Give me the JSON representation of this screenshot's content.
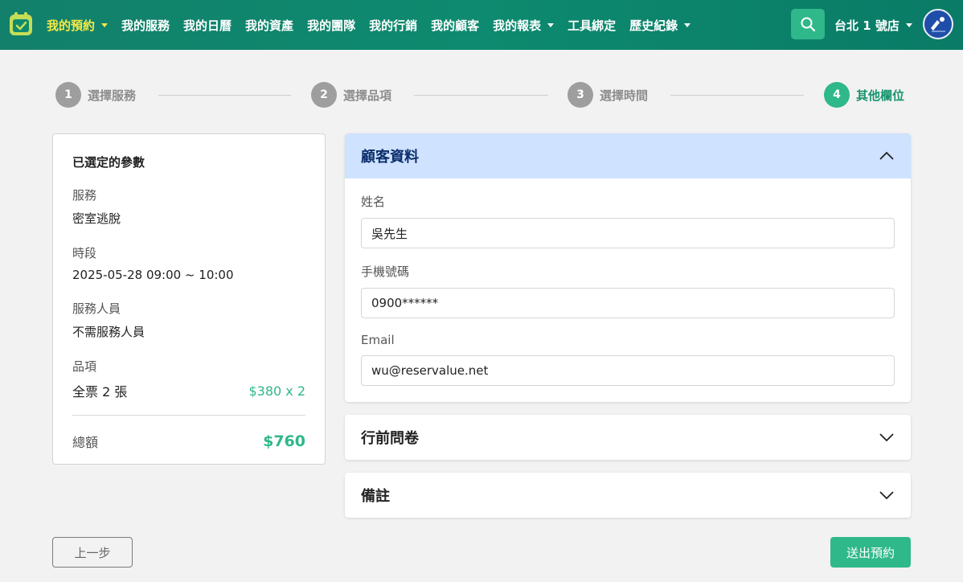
{
  "colors": {
    "brand": "#0d8a6f",
    "accent": "#2fb88a",
    "active_nav": "#f6ea45",
    "open_panel_bg": "#cfe2ff"
  },
  "nav": {
    "logo_icon": "calendar-check-icon",
    "items": [
      {
        "label": "我的預約",
        "has_caret": true,
        "active": true
      },
      {
        "label": "我的服務",
        "has_caret": false
      },
      {
        "label": "我的日曆",
        "has_caret": false
      },
      {
        "label": "我的資產",
        "has_caret": false
      },
      {
        "label": "我的團隊",
        "has_caret": false
      },
      {
        "label": "我的行銷",
        "has_caret": false
      },
      {
        "label": "我的顧客",
        "has_caret": false
      },
      {
        "label": "我的報表",
        "has_caret": true
      },
      {
        "label": "工具綁定",
        "has_caret": false
      },
      {
        "label": "歷史紀錄",
        "has_caret": true
      }
    ],
    "search_icon": "search-icon",
    "store": "台北 1 號店"
  },
  "stepper": {
    "steps": [
      {
        "num": "1",
        "label": "選擇服務",
        "active": false
      },
      {
        "num": "2",
        "label": "選擇品項",
        "active": false
      },
      {
        "num": "3",
        "label": "選擇時間",
        "active": false
      },
      {
        "num": "4",
        "label": "其他欄位",
        "active": true
      }
    ]
  },
  "summary": {
    "title": "已選定的參數",
    "service_label": "服務",
    "service_value": "密室逃脫",
    "slot_label": "時段",
    "slot_value": "2025-05-28 09:00 ~ 10:00",
    "staff_label": "服務人員",
    "staff_value": "不需服務人員",
    "items_label": "品項",
    "item_name": "全票 2 張",
    "item_price": "$380 x 2",
    "total_label": "總額",
    "total_value": "$760"
  },
  "customer_panel": {
    "title": "顧客資料",
    "name_label": "姓名",
    "name_value": "吳先生",
    "phone_label": "手機號碼",
    "phone_value": "0900******",
    "email_label": "Email",
    "email_value": "wu@reservalue.net"
  },
  "survey_panel": {
    "title": "行前問卷"
  },
  "notes_panel": {
    "title": "備註"
  },
  "actions": {
    "prev_label": "上一步",
    "submit_label": "送出預約"
  }
}
